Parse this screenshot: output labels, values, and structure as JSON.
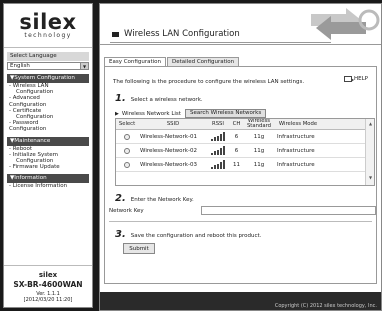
{
  "sidebar": {
    "logo_word": "silex",
    "logo_tagline": "technology",
    "language_label": "Select Language",
    "language_value": "English",
    "system_config": {
      "header": "▼System Configuration",
      "items": [
        "- Wireless LAN",
        "Configuration",
        "- Advanced",
        "Configuration",
        "- Certificate",
        "Configuration",
        "- Password",
        "Configuration"
      ]
    },
    "maintenance": {
      "header": "▼Maintenance",
      "items": [
        "- Reboot",
        "- Initialize System",
        "Configuration",
        "- Firmware Update"
      ]
    },
    "information": {
      "header": "▼Information",
      "items": [
        "- License Information"
      ]
    },
    "model_brand": "silex",
    "model_name": "SX-BR-4600WAN",
    "version_line1": "Ver. 1.1.1",
    "version_line2": "[2012/03/20 11:20]"
  },
  "main": {
    "title": "Wireless LAN Configuration",
    "tabs": [
      {
        "label": "Easy Configuration",
        "active": true
      },
      {
        "label": "Detailed Configuration",
        "active": false
      }
    ],
    "intro": "The following is the procedure to configure the wireless LAN settings.",
    "help_label": "HELP",
    "step1": {
      "num": "1.",
      "text": "Select a wireless network."
    },
    "network_list_label": "Wireless Network List",
    "search_button": "Search Wireless Networks",
    "table": {
      "headers": {
        "select": "Select",
        "ssid": "SSID",
        "rssi": "RSSI",
        "ch": "CH",
        "standard": "Wireless Standard",
        "mode": "Wireless Mode"
      },
      "rows": [
        {
          "ssid": "Wireless-Network-01",
          "rssi": 5,
          "ch": "6",
          "standard": "11g",
          "mode": "Infrastructure"
        },
        {
          "ssid": "Wireless-Network-02",
          "rssi": 5,
          "ch": "6",
          "standard": "11g",
          "mode": "Infrastructure"
        },
        {
          "ssid": "Wireless-Network-03",
          "rssi": 5,
          "ch": "11",
          "standard": "11g",
          "mode": "Infrastructure"
        }
      ]
    },
    "step2": {
      "num": "2.",
      "text": "Enter the Network Key."
    },
    "network_key_label": "Network Key",
    "network_key_value": "",
    "step3": {
      "num": "3.",
      "text": "Save the configuration and reboot this product."
    },
    "submit_button": "Submit",
    "copyright": "Copyright (C) 2012 silex technology, Inc."
  },
  "colors": {
    "sidebar_header": "#4a4a4a",
    "footer": "#2a2a2a",
    "page_bg": "#1a1a1a"
  }
}
